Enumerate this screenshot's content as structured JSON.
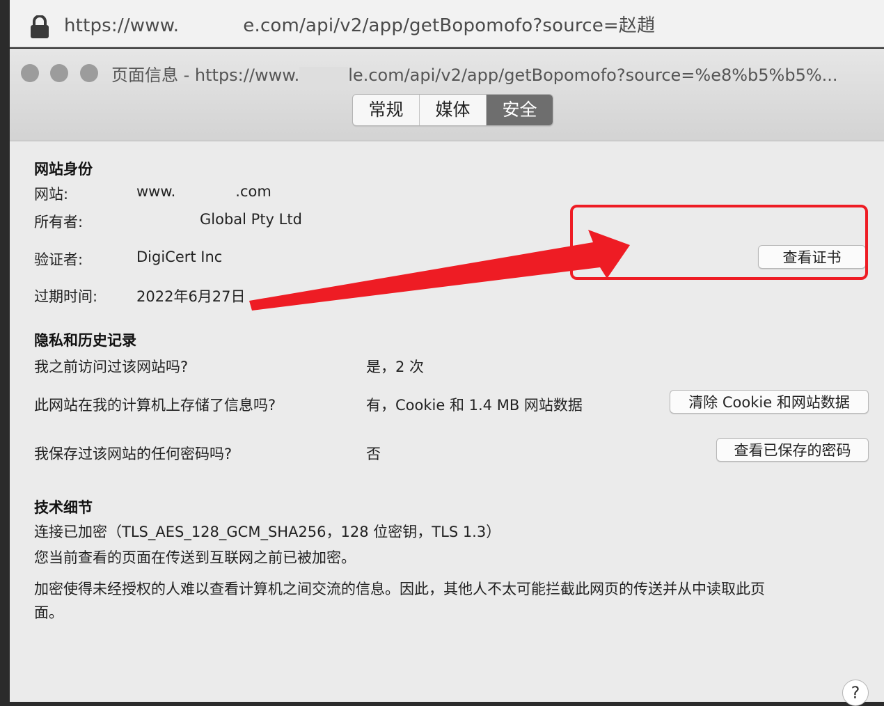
{
  "urlbar": {
    "url_prefix": "https://www.",
    "url_suffix": "e.com/api/v2/app/getBopomofo?source=赵趙"
  },
  "window": {
    "title_prefix": "页面信息 - https://www.",
    "title_suffix": "le.com/api/v2/app/getBopomofo?source=%e8%b5%b5%..."
  },
  "tabs": [
    {
      "label": "常规",
      "active": false
    },
    {
      "label": "媒体",
      "active": false
    },
    {
      "label": "安全",
      "active": true
    }
  ],
  "identity": {
    "heading": "网站身份",
    "site_label": "网站:",
    "site_value_prefix": "www.",
    "site_value_suffix": ".com",
    "owner_label": "所有者:",
    "owner_value": "Global Pty Ltd",
    "verifier_label": "验证者:",
    "verifier_value": "DigiCert Inc",
    "view_cert_button": "查看证书",
    "expiry_label": "过期时间:",
    "expiry_value": "2022年6月27日"
  },
  "privacy": {
    "heading": "隐私和历史记录",
    "q1": "我之前访问过该网站吗?",
    "a1": "是，2 次",
    "q2": "此网站在我的计算机上存储了信息吗?",
    "a2": "有，Cookie 和 1.4 MB 网站数据",
    "clear_button": "清除 Cookie 和网站数据",
    "q3": "我保存过该网站的任何密码吗?",
    "a3": "否",
    "passwords_button": "查看已保存的密码"
  },
  "technical": {
    "heading": "技术细节",
    "line1": "连接已加密（TLS_AES_128_GCM_SHA256，128 位密钥，TLS 1.3）",
    "line2": "您当前查看的页面在传送到互联网之前已被加密。",
    "line3": "加密使得未经授权的人难以查看计算机之间交流的信息。因此，其他人不太可能拦截此网页的传送并从中读取此页",
    "line4": "面。"
  },
  "help": {
    "label": "?"
  },
  "colors": {
    "annotation_red": "#ee1c24",
    "active_tab": "#6e6e6e",
    "window_bg": "#ebebeb"
  }
}
